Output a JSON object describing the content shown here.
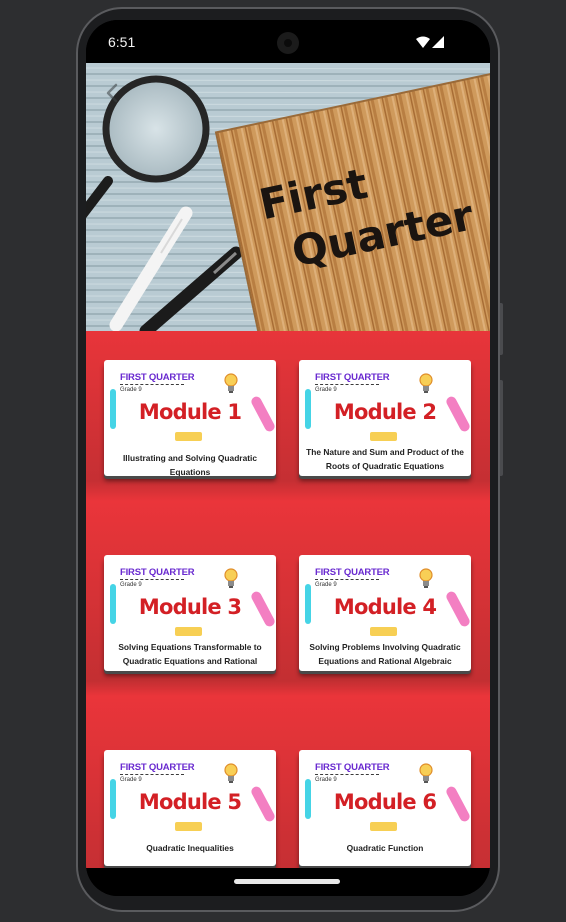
{
  "status_bar": {
    "time": "6:51",
    "icons": [
      "wifi-icon",
      "signal-icon"
    ]
  },
  "banner": {
    "line1": "First",
    "line2": "Quarter"
  },
  "modules": [
    {
      "header": "FIRST QUARTER",
      "grade": "Grade 9",
      "title": "Module 1",
      "description": "Illustrating and Solving Quadratic Equations"
    },
    {
      "header": "FIRST QUARTER",
      "grade": "Grade 9",
      "title": "Module 2",
      "description": "The Nature and Sum and Product of the Roots of Quadratic Equations"
    },
    {
      "header": "FIRST QUARTER",
      "grade": "Grade 9",
      "title": "Module 3",
      "description": "Solving Equations Transformable to Quadratic Equations and Rational Algebraic Equations"
    },
    {
      "header": "FIRST QUARTER",
      "grade": "Grade 9",
      "title": "Module 4",
      "description": "Solving Problems Involving Quadratic Equations and Rational Algebraic Equations"
    },
    {
      "header": "FIRST QUARTER",
      "grade": "Grade 9",
      "title": "Module 5",
      "description": "Quadratic Inequalities"
    },
    {
      "header": "FIRST QUARTER",
      "grade": "Grade 9",
      "title": "Module 6",
      "description": "Quadratic Function"
    }
  ],
  "colors": {
    "background": "#d42d2d",
    "module_title": "#d32025",
    "header_purple": "#6a2bd0"
  }
}
